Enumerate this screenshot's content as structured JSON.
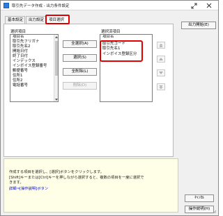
{
  "window": {
    "title": "取引先データ作成 - 出力条件設定"
  },
  "tabs": [
    {
      "label": "基本設定"
    },
    {
      "label": "出力設定"
    },
    {
      "label": "項目選択"
    }
  ],
  "buttons": {
    "output_start": "出力開始(E)",
    "select_all": "全選択(A)",
    "select": "選択(S)",
    "deselect_all": "全削除(L)",
    "delete": "削除(D)",
    "cancel": "ｷｬﾝｾﾙ",
    "help": "操作説明(H)"
  },
  "source": {
    "label": "選択項目",
    "items": [
      "項目名",
      "取引先フリガナ",
      "取引先名2",
      "開始日付",
      "終了日付",
      "インデックス",
      "インボイス登録番号",
      "郵便番号",
      "住所1",
      "住所2",
      "電話番号"
    ]
  },
  "selected": {
    "label": "選択済項目",
    "items": [
      "項目名",
      "取引先コード",
      "取引先名1",
      "インボイス登録区分"
    ]
  },
  "hint": {
    "line1": "作成する項目を選択し、[選択]ボタンをクリックします。",
    "line2": "[Shift]キーまたは[Ctrl]キーを押しながら選択すると、複数の項目を一度に選択で",
    "line3": "きます。",
    "link": "詳細⇒[操作説明]ボタン"
  }
}
